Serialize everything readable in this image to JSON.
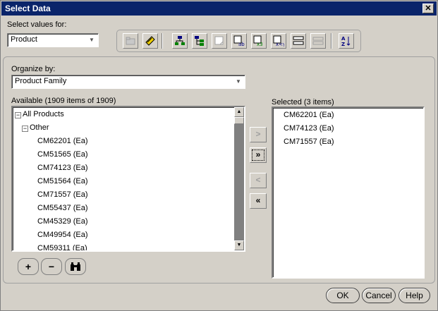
{
  "window": {
    "title": "Select Data"
  },
  "select_values": {
    "label": "Select values for:",
    "value": "Product"
  },
  "toolbar": {
    "icons": [
      "folder-icon",
      "save-selection-icon",
      "hierarchy-icon",
      "hierarchy-levels-icon",
      "exception-icon",
      "attribute-ab-icon",
      "match-x3-icon",
      "match-xy-icon",
      "rows-icon",
      "rows-disabled-icon",
      "sort-az-icon"
    ]
  },
  "organize": {
    "label": "Organize by:",
    "value": "Product Family"
  },
  "available": {
    "label": "Available (1909 items of 1909)",
    "items": [
      {
        "text": "All Products",
        "level": 0,
        "expander": "−"
      },
      {
        "text": "Other",
        "level": 1,
        "expander": "−"
      },
      {
        "text": "CM62201 (Ea)",
        "level": 2
      },
      {
        "text": "CM51565 (Ea)",
        "level": 2
      },
      {
        "text": "CM74123 (Ea)",
        "level": 2
      },
      {
        "text": "CM51564 (Ea)",
        "level": 2
      },
      {
        "text": "CM71557 (Ea)",
        "level": 2
      },
      {
        "text": "CM55437 (Ea)",
        "level": 2
      },
      {
        "text": "CM45329 (Ea)",
        "level": 2
      },
      {
        "text": "CM49954 (Ea)",
        "level": 2
      },
      {
        "text": "CM59311 (Ea)",
        "level": 2
      }
    ]
  },
  "selected": {
    "label": "Selected (3 items)",
    "items": [
      "CM62201 (Ea)",
      "CM74123 (Ea)",
      "CM71557 (Ea)"
    ]
  },
  "move_buttons": {
    "add": ">",
    "add_all": "»",
    "remove": "<",
    "remove_all": "«"
  },
  "bottom_tools": {
    "expand": "+",
    "collapse": "−",
    "find": "find-icon"
  },
  "buttons": {
    "ok": "OK",
    "cancel": "Cancel",
    "help": "Help"
  },
  "colors": {
    "titlebar": "#0a246a",
    "face": "#d4d0c8",
    "toolbar_accent": "#000080"
  }
}
